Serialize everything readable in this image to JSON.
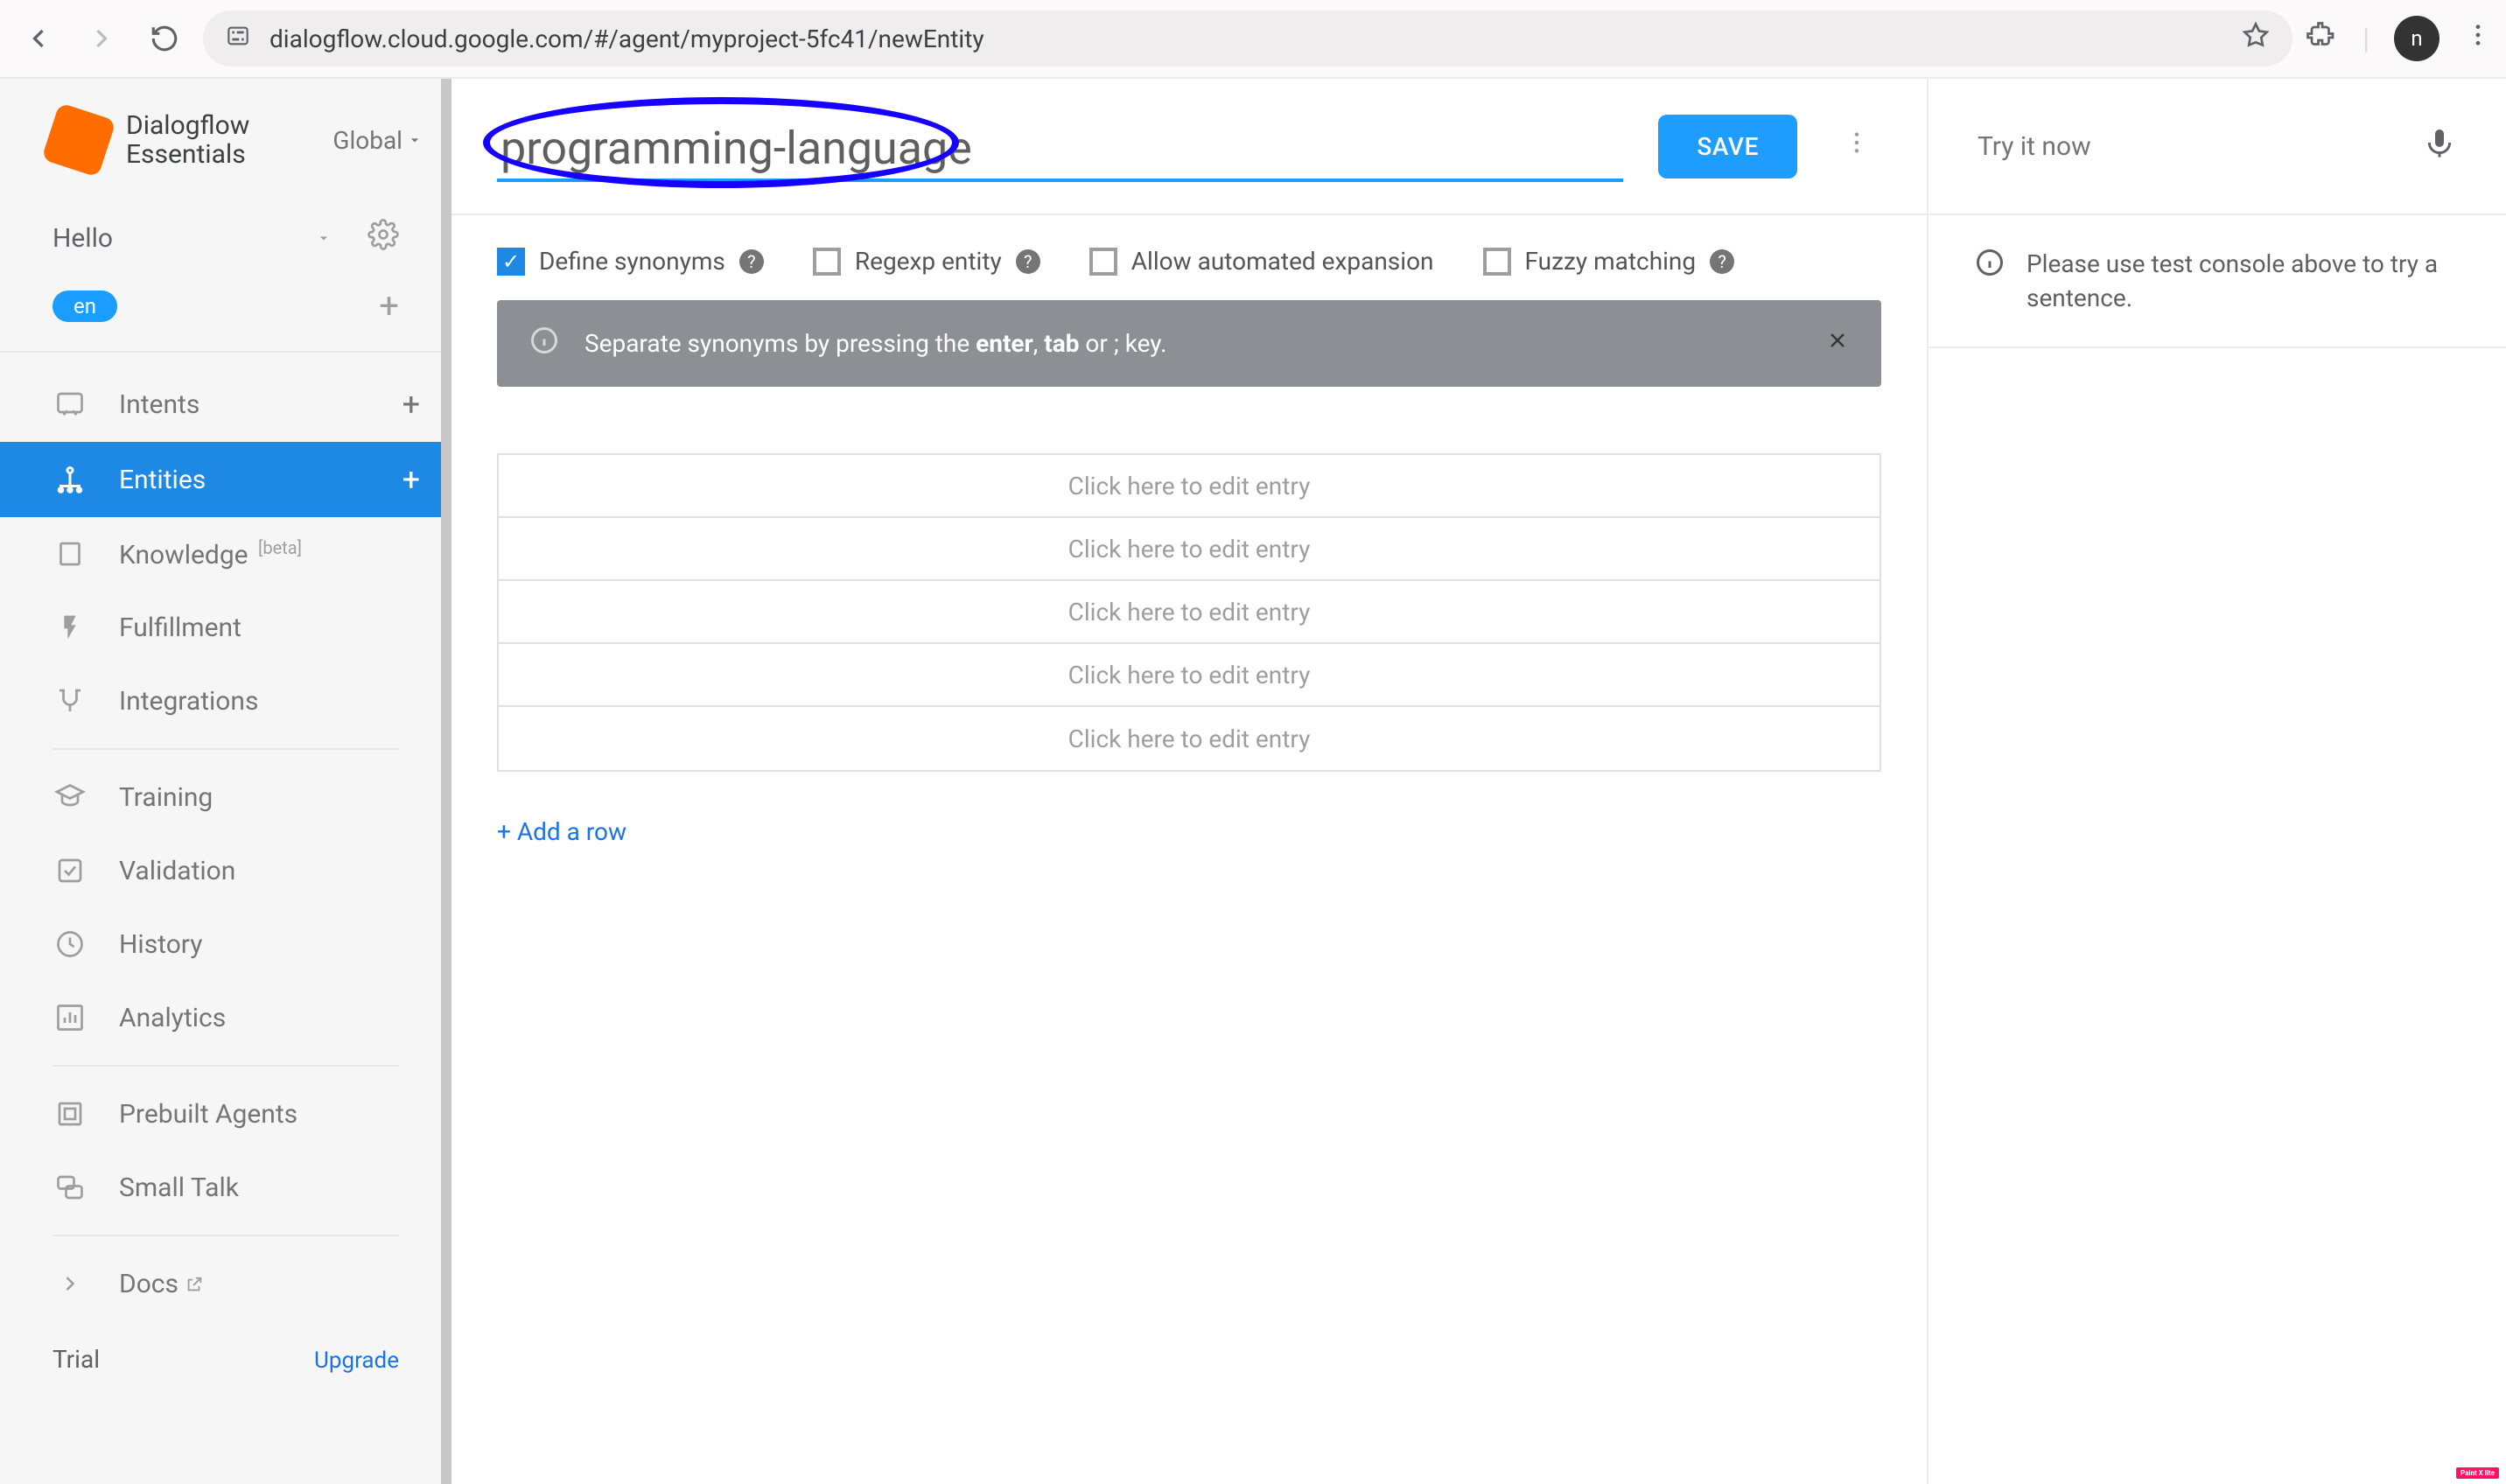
{
  "browser": {
    "url": "dialogflow.cloud.google.com/#/agent/myproject-5fc41/newEntity",
    "avatar_letter": "n"
  },
  "brand": {
    "line1": "Dialogflow",
    "line2": "Essentials",
    "scope": "Global"
  },
  "agent": {
    "name": "Hello",
    "language": "en"
  },
  "sidebar": {
    "intents": "Intents",
    "entities": "Entities",
    "knowledge": "Knowledge",
    "knowledge_badge": "[beta]",
    "fulfillment": "Fulfillment",
    "integrations": "Integrations",
    "training": "Training",
    "validation": "Validation",
    "history": "History",
    "analytics": "Analytics",
    "prebuilt": "Prebuilt Agents",
    "smalltalk": "Small Talk",
    "docs": "Docs",
    "trial": "Trial",
    "upgrade": "Upgrade"
  },
  "entity": {
    "name": "programming-language",
    "save": "SAVE",
    "opts": {
      "define_synonyms": "Define synonyms",
      "regexp": "Regexp entity",
      "auto_expand": "Allow automated expansion",
      "fuzzy": "Fuzzy matching"
    },
    "banner_pre": "Separate synonyms by pressing the ",
    "banner_enter": "enter",
    "banner_mid": ", ",
    "banner_tab": "tab",
    "banner_post": " or ; key.",
    "entry_placeholder": "Click here to edit entry",
    "add_row": "+ Add a row"
  },
  "rightp": {
    "try": "Try it now",
    "info": "Please use test console above to try a sentence."
  },
  "badge": "Paint X lite"
}
